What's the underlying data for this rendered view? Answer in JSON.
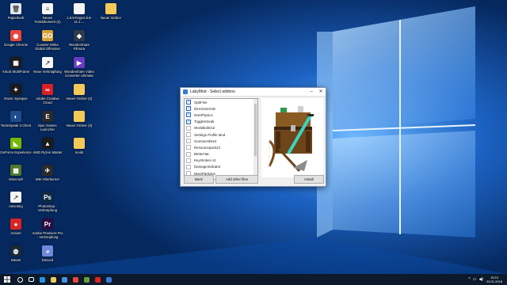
{
  "desktop": {
    "icons": [
      {
        "label": "Papierkorb",
        "icon": "recycle-bin-icon",
        "color": "#dfe7ef",
        "glyph": "🗑"
      },
      {
        "label": "Neues Textdokument (2)",
        "icon": "text-file-icon",
        "color": "#f4f4f4",
        "glyph": "≡"
      },
      {
        "label": "1.8.9-forge1.8.9-11.1....",
        "icon": "file-icon",
        "color": "#f4f4f4",
        "glyph": ""
      },
      {
        "label": "Neuer Ordner",
        "icon": "folder-icon",
        "color": "#f3c95a",
        "glyph": ""
      },
      {
        "label": "Google Chrome",
        "icon": "chrome-icon",
        "color": "#e8463b",
        "glyph": "◉"
      },
      {
        "label": "Counter-Strike Global Offensive",
        "icon": "csgo-icon",
        "color": "#d8a23a",
        "glyph": "GO"
      },
      {
        "label": "Wondershare Filmora",
        "icon": "filmora-icon",
        "color": "#2f3a4a",
        "glyph": "◆"
      },
      {
        "label": "ASUS MultiFrame",
        "icon": "asus-icon",
        "color": "#1b1b1b",
        "glyph": "▦"
      },
      {
        "label": "Neue Verknüpfung",
        "icon": "shortcut-icon",
        "color": "#f4f4f4",
        "glyph": "↗"
      },
      {
        "label": "Wondershare Video Converter Ultimate",
        "icon": "video-converter-icon",
        "color": "#6a3bc2",
        "glyph": "▶"
      },
      {
        "label": "Razer Synapse",
        "icon": "razer-icon",
        "color": "#1a1a1a",
        "glyph": "✦"
      },
      {
        "label": "Adobe Creative Cloud",
        "icon": "creative-cloud-icon",
        "color": "#da1f26",
        "glyph": "∞"
      },
      {
        "label": "Neuer Ordner (2)",
        "icon": "folder-icon",
        "color": "#f3c95a",
        "glyph": ""
      },
      {
        "label": "TeamSpeak 3 Client",
        "icon": "teamspeak-icon",
        "color": "#1d4c8c",
        "glyph": "◐"
      },
      {
        "label": "Epic Games Launcher",
        "icon": "epic-games-icon",
        "color": "#2a2a2a",
        "glyph": "E"
      },
      {
        "label": "Neuer Ordner (3)",
        "icon": "folder-icon",
        "color": "#f3c95a",
        "glyph": ""
      },
      {
        "label": "GeForce Experience",
        "icon": "geforce-icon",
        "color": "#76b900",
        "glyph": "◣"
      },
      {
        "label": "AMD Ryzen Master",
        "icon": "amd-icon",
        "color": "#1a1a1a",
        "glyph": "▲"
      },
      {
        "label": "mods",
        "icon": "folder-icon",
        "color": "#f3c95a",
        "glyph": ""
      },
      {
        "label": "Minecraft",
        "icon": "minecraft-icon",
        "color": "#4d7a2c",
        "glyph": "▩"
      },
      {
        "label": "MSI Afterburner",
        "icon": "msi-afterburner-icon",
        "color": "#2b2b2b",
        "glyph": "✈"
      },
      {
        "label": "netvoting",
        "icon": "netvoting-icon",
        "color": "#f4f4f4",
        "glyph": "↗"
      },
      {
        "label": "Photoshop - Verknüpfung",
        "icon": "photoshop-icon",
        "color": "#0f2a44",
        "glyph": "Ps"
      },
      {
        "label": "Action!",
        "icon": "action-icon",
        "color": "#d92525",
        "glyph": "●"
      },
      {
        "label": "Adobe Premiere Pro - Verknüpfung",
        "icon": "premiere-icon",
        "color": "#2b0c40",
        "glyph": "Pr"
      },
      {
        "label": "Steam",
        "icon": "steam-icon",
        "color": "#1b2838",
        "glyph": "◍"
      },
      {
        "label": "Discord",
        "icon": "discord-icon",
        "color": "#7289da",
        "glyph": "◕"
      }
    ]
  },
  "dialog": {
    "title": "LabyMod - Select addons",
    "addons": [
      {
        "name": "OptiFine",
        "checked": true
      },
      {
        "name": "DirectionHUD",
        "checked": true
      },
      {
        "name": "ItemPhysics",
        "checked": true
      },
      {
        "name": "ToggleSneak",
        "checked": true
      },
      {
        "name": "WorldEditCUI",
        "checked": false
      },
      {
        "name": "Settings Profile Mod",
        "checked": false
      },
      {
        "name": "GommeHDnet",
        "checked": false
      },
      {
        "name": "Resourcepack24",
        "checked": false
      },
      {
        "name": "BetterHat",
        "checked": false
      },
      {
        "name": "Keystrokes v2",
        "checked": false
      },
      {
        "name": "DamageIndicator",
        "checked": false
      },
      {
        "name": "MoreParticles",
        "checked": false
      }
    ],
    "back_label": "Back",
    "add_files_label": "Add other files",
    "install_label": "Install"
  },
  "taskbar": {
    "apps": [
      {
        "icon": "search-icon",
        "color": "#ffffff"
      },
      {
        "icon": "task-view-icon",
        "color": "#ffffff"
      },
      {
        "icon": "edge-icon",
        "color": "#2f8fe0"
      },
      {
        "icon": "file-explorer-icon",
        "color": "#f3c95a"
      },
      {
        "icon": "store-icon",
        "color": "#4a90e2"
      },
      {
        "icon": "chrome-icon",
        "color": "#e8463b"
      },
      {
        "icon": "minecraft-icon",
        "color": "#6d9b3a"
      },
      {
        "icon": "opera-icon",
        "color": "#e02424"
      },
      {
        "icon": "installer-icon",
        "color": "#3a7bd5"
      }
    ],
    "time": "15:10",
    "date": "20.01.2018",
    "tray_chevron": "^",
    "tray_network": "▭",
    "tray_volume": "◀)"
  }
}
